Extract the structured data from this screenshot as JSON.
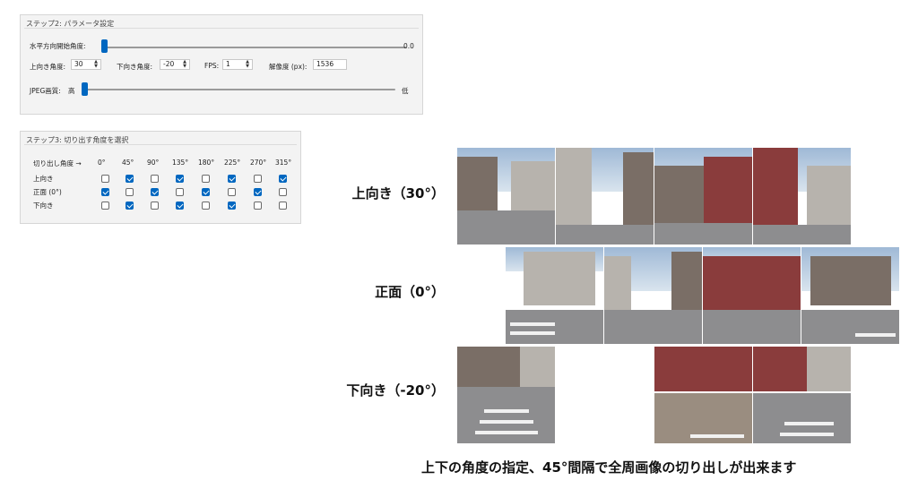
{
  "step2": {
    "title": "ステップ2: パラメータ設定",
    "h_start_label": "水平方向開始角度:",
    "h_start_value": "0.0",
    "h_start_level": 0.0,
    "up_angle_label": "上向き角度:",
    "up_angle_value": "30",
    "down_angle_label": "下向き角度:",
    "down_angle_value": "-20",
    "fps_label": "FPS:",
    "fps_value": "1",
    "resolution_label": "解像度 (px):",
    "resolution_value": "1536",
    "jpeg_label": "JPEG画質:",
    "jpeg_high": "高",
    "jpeg_low": "低",
    "jpeg_level": 0.0
  },
  "step3": {
    "title": "ステップ3: 切り出す角度を選択",
    "header_label": "切り出し角度 →",
    "angles": [
      "0°",
      "45°",
      "90°",
      "135°",
      "180°",
      "225°",
      "270°",
      "315°"
    ],
    "rows": [
      {
        "label": "上向き",
        "checks": [
          false,
          true,
          false,
          true,
          false,
          true,
          false,
          true
        ]
      },
      {
        "label": "正面 (0°)",
        "checks": [
          true,
          false,
          true,
          false,
          true,
          false,
          true,
          false
        ]
      },
      {
        "label": "下向き",
        "checks": [
          false,
          true,
          false,
          true,
          false,
          true,
          false,
          false
        ]
      }
    ]
  },
  "preview": {
    "up_label": "上向き（30°）",
    "front_label": "正面（0°）",
    "down_label": "下向き（-20°）"
  },
  "caption": "上下の角度の指定、45°間隔で全周画像の切り出しが出来ます",
  "colors": {
    "accent": "#0067c0",
    "panel_bg": "#f3f3f3"
  }
}
